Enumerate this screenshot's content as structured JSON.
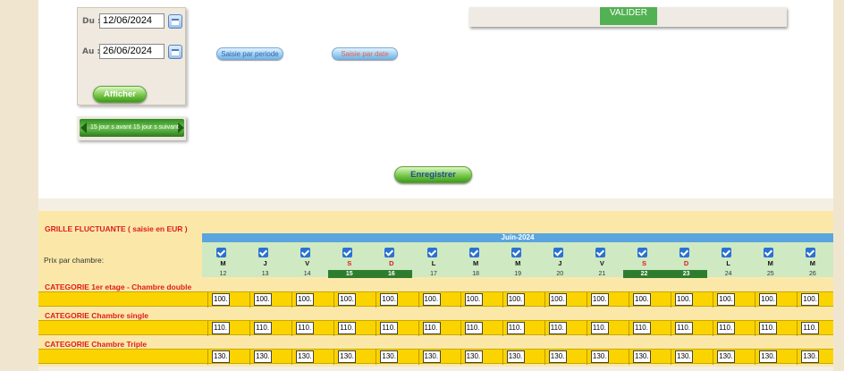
{
  "filters": {
    "du_label": "Du :",
    "du_value": "12/06/2024",
    "au_label": "Au :",
    "au_value": "26/06/2024",
    "afficher": "Afficher",
    "nav_label": "15 jour s avant 15 jour s suivant"
  },
  "actions": {
    "saisie_periode": "Saisie par periode",
    "saisie_date": "Saisie par date",
    "enregistrer": "Enregistrer",
    "valider": "VALIDER"
  },
  "grid": {
    "title": "GRILLE FLUCTUANTE ( saisie en EUR )",
    "month": "Juin-2024",
    "row_label": "Prix par chambre:",
    "days": [
      {
        "letter": "M",
        "num": "12",
        "weekend": false
      },
      {
        "letter": "J",
        "num": "13",
        "weekend": false
      },
      {
        "letter": "V",
        "num": "14",
        "weekend": false
      },
      {
        "letter": "S",
        "num": "15",
        "weekend": true
      },
      {
        "letter": "D",
        "num": "16",
        "weekend": true
      },
      {
        "letter": "L",
        "num": "17",
        "weekend": false
      },
      {
        "letter": "M",
        "num": "18",
        "weekend": false
      },
      {
        "letter": "M",
        "num": "19",
        "weekend": false
      },
      {
        "letter": "J",
        "num": "20",
        "weekend": false
      },
      {
        "letter": "V",
        "num": "21",
        "weekend": false
      },
      {
        "letter": "S",
        "num": "22",
        "weekend": true
      },
      {
        "letter": "D",
        "num": "23",
        "weekend": true
      },
      {
        "letter": "L",
        "num": "24",
        "weekend": false
      },
      {
        "letter": "M",
        "num": "25",
        "weekend": false
      },
      {
        "letter": "M",
        "num": "26",
        "weekend": false
      }
    ],
    "categories": [
      {
        "name": "CATEGORIE 1er etage - Chambre double",
        "price": "100."
      },
      {
        "name": "CATEGORIE Chambre single",
        "price": "110."
      },
      {
        "name": "CATEGORIE Chambre Triple",
        "price": "130."
      }
    ]
  },
  "colors": {
    "weekend_letter": "#e01b1b",
    "weekday_letter": "#111111",
    "checkbox": "#2a72d2",
    "category_band": "#fbd400"
  }
}
